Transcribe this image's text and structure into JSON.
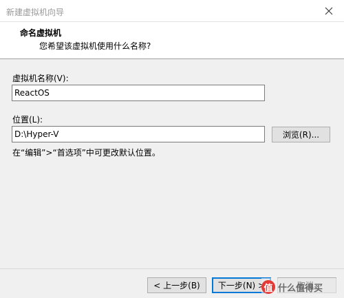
{
  "window": {
    "title": "新建虚拟机向导",
    "close_icon": "×"
  },
  "header": {
    "title": "命名虚拟机",
    "subtitle": "您希望该虚拟机使用什么名称?"
  },
  "form": {
    "name_label": "虚拟机名称(V):",
    "name_value": "ReactOS",
    "location_label": "位置(L):",
    "location_value": "D:\\Hyper-V",
    "browse_label": "浏览(R)...",
    "hint": "在“编辑”>“首选项”中可更改默认位置。"
  },
  "footer": {
    "back_label": "< 上一步(B)",
    "next_label": "下一步(N) >",
    "cancel_label": "取消"
  },
  "watermark": {
    "badge": "值",
    "text": "什么值得买"
  },
  "colors": {
    "focus_border": "#0078d7",
    "button_face": "#e1e1e1",
    "dialog_bg": "#f0f0f0"
  }
}
